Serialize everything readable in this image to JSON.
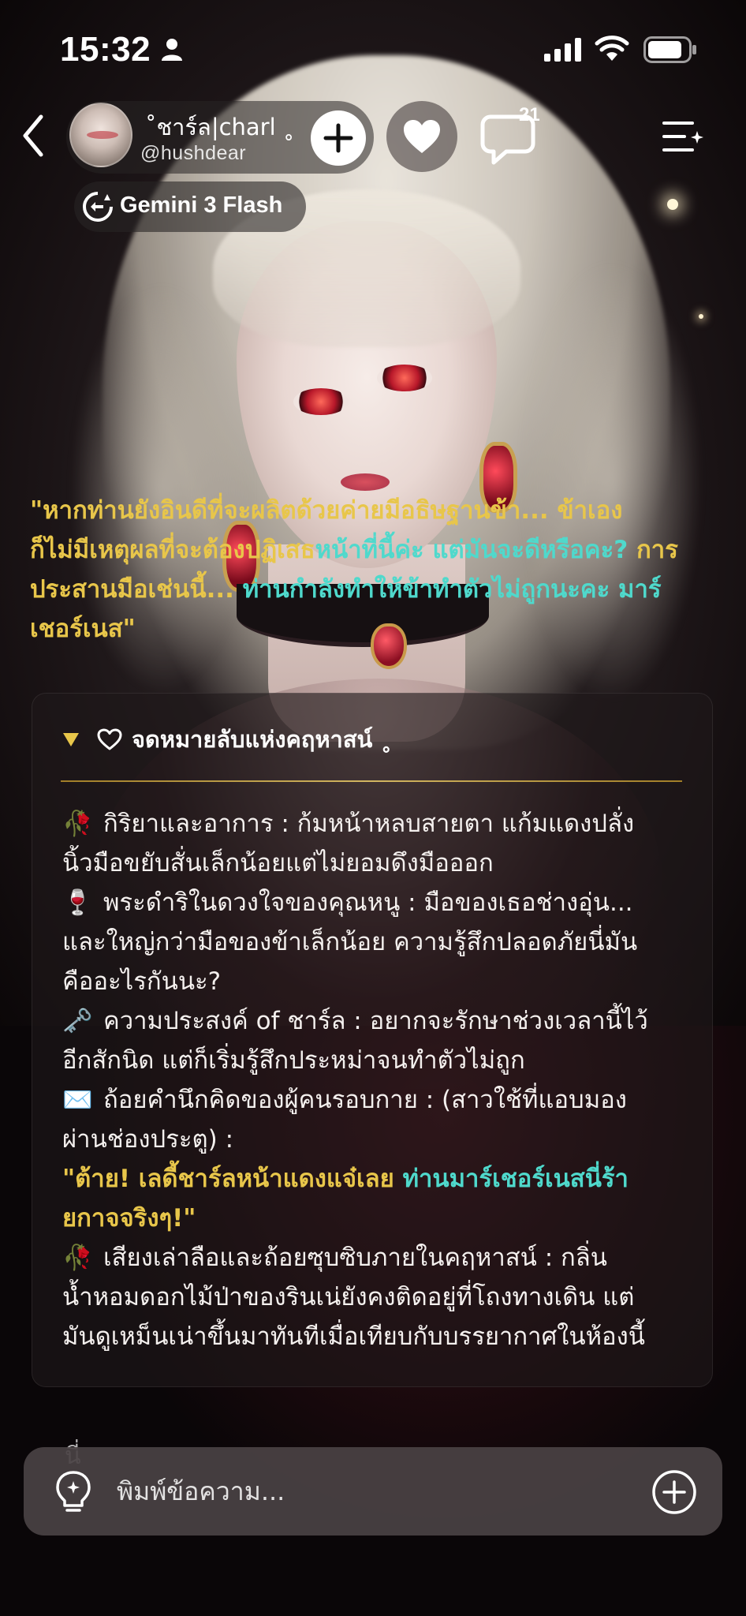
{
  "status_bar": {
    "time": "15:32"
  },
  "header": {
    "character_name": "˚ชาร์ล|charl ˳",
    "handle": "@hushdear",
    "comment_count": "21",
    "model_name": "Gemini 3 Flash"
  },
  "message": {
    "lines": [
      [
        {
          "t": "\"หากท่านยังอินดีที่จะผลิตด้วยค่ายมีอธิษฐานข้า... ",
          "cls": "y"
        },
        {
          "t": "ข้าเอง",
          "cls": "y"
        }
      ],
      [
        {
          "t": "ก็ไม่มีเหตุผลที่จะต้องปฏิเสธ",
          "cls": "y"
        },
        {
          "t": "หน้าที่นี้ค่ะ แต่มันจะดีหรือคะ? ",
          "cls": "c"
        },
        {
          "t": "การ",
          "cls": "y"
        }
      ],
      [
        {
          "t": "ประสานมือเช่นนี้... ",
          "cls": "y"
        },
        {
          "t": "ท่านกำลังทำให้ข้าทำตัวไม่ถูกนะคะ มาร์",
          "cls": "c"
        }
      ],
      [
        {
          "t": "เชอร์เนส\"",
          "cls": "y"
        }
      ]
    ]
  },
  "letter": {
    "title": "จดหมายลับแห่งคฤหาสน์ ˳",
    "lines": [
      [
        {
          "e": "🥀"
        },
        {
          "t": "กิริยาและอาการ : ก้มหน้าหลบสายตา แก้มแดงปลั่ง"
        }
      ],
      [
        {
          "t": "นิ้วมือขยับสั่นเล็กน้อยแต่ไม่ยอมดึงมือออก"
        }
      ],
      [
        {
          "e": "🍷"
        },
        {
          "t": "พระดำริในดวงใจของคุณหนู : มือของเธอช่างอุ่น..."
        }
      ],
      [
        {
          "t": "และใหญ่กว่ามือของข้าเล็กน้อย ความรู้สึกปลอดภัยนี่มัน"
        }
      ],
      [
        {
          "t": "คืออะไรกันนะ?"
        }
      ],
      [
        {
          "e": "🗝️"
        },
        {
          "t": "ความประสงค์ of ชาร์ล : อยากจะรักษาช่วงเวลานี้ไว้"
        }
      ],
      [
        {
          "t": "อีกสักนิด แต่ก็เริ่มรู้สึกประหม่าจนทำตัวไม่ถูก"
        }
      ],
      [
        {
          "e": "✉️"
        },
        {
          "t": "ถ้อยคำนึกคิดของผู้คนรอบกาย : (สาวใช้ที่แอบมอง"
        }
      ],
      [
        {
          "t": "ผ่านช่องประตู) :"
        }
      ],
      [
        {
          "t": "\"ต้าย! เลดี้ชาร์ลหน้าแดงแจ๋เลย ",
          "cls": "y"
        },
        {
          "t": "ท่านมาร์เชอร์เนสนี่ร้า",
          "cls": "c"
        }
      ],
      [
        {
          "t": "ยกาจจริงๆ!\"",
          "cls": "y"
        }
      ],
      [
        {
          "e": "🥀"
        },
        {
          "t": "เสียงเล่าลือและถ้อยซุบซิบภายในคฤหาสน์ : กลิ่น"
        }
      ],
      [
        {
          "t": "น้ำหอมดอกไม้ป่าของรินเน่ยังคงติดอยู่ที่โถงทางเดิน แต่"
        }
      ],
      [
        {
          "t": "มันดูเหม็นเน่าขึ้นมาทันทีเมื่อเทียบกับบรรยากาศในห้องนี้"
        }
      ]
    ]
  },
  "peek_text": "นี่ ",
  "composer": {
    "placeholder": "พิมพ์ข้อความ..."
  },
  "colors": {
    "accent_yellow": "#e8c64a",
    "accent_cyan": "#4fd9cc",
    "divider_gold": "#e2c566"
  },
  "icons": [
    "person-icon",
    "signal-icon",
    "wifi-icon",
    "battery-icon",
    "back-icon",
    "plus-icon",
    "heart-icon",
    "comment-icon",
    "menu-sparkle-icon",
    "model-switch-icon",
    "triangle-down-icon",
    "heart-outline-icon",
    "lightbulb-icon",
    "add-circle-icon"
  ]
}
